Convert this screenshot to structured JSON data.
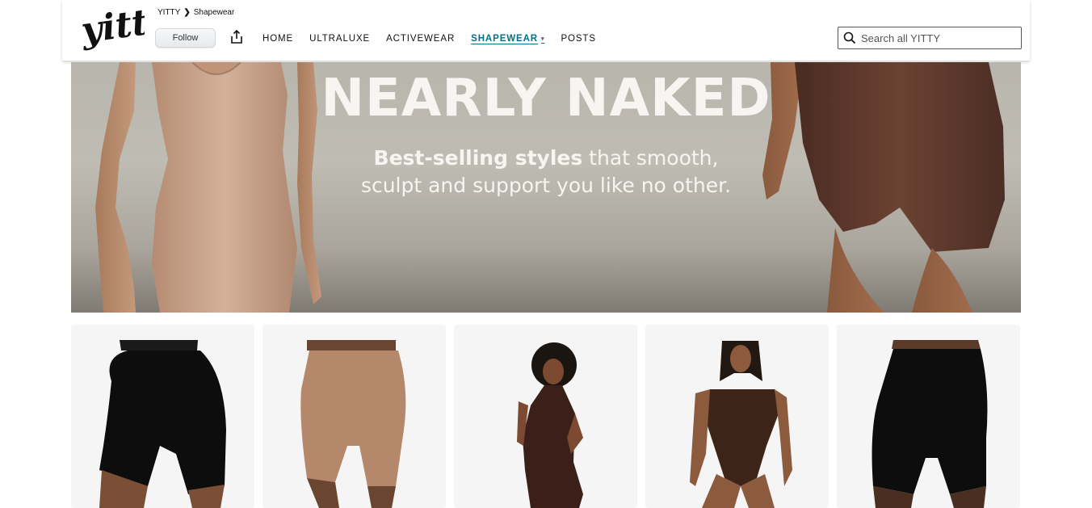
{
  "brand": {
    "logo_text": "yitty"
  },
  "breadcrumb": {
    "store": "YITTY",
    "separator": "❯",
    "current": "Shapewear"
  },
  "actions": {
    "follow_label": "Follow",
    "share_icon": "share-icon"
  },
  "nav": {
    "items": [
      {
        "label": "HOME",
        "active": false
      },
      {
        "label": "ULTRALUXE",
        "active": false
      },
      {
        "label": "ACTIVEWEAR",
        "active": false
      },
      {
        "label": "SHAPEWEAR",
        "active": true,
        "caret": "▾"
      },
      {
        "label": "POSTS",
        "active": false
      }
    ]
  },
  "search": {
    "placeholder": "Search all YITTY",
    "icon": "search-icon"
  },
  "hero": {
    "title": "NEARLY NAKED",
    "subtitle_bold": "Best-selling styles",
    "subtitle_rest_1": " that smooth,",
    "subtitle_line_2": "sculpt and support you like no other."
  },
  "products": [
    {
      "image": "black-high-waist-shorts"
    },
    {
      "image": "nude-high-waist-shorts"
    },
    {
      "image": "brown-bodysuit-model"
    },
    {
      "image": "brown-thong-bodysuit-model"
    },
    {
      "image": "black-high-waist-shorts-2"
    }
  ],
  "colors": {
    "accent": "#007185",
    "hero_text": "#f6f5f1",
    "card_bg": "#f5f5f5"
  }
}
